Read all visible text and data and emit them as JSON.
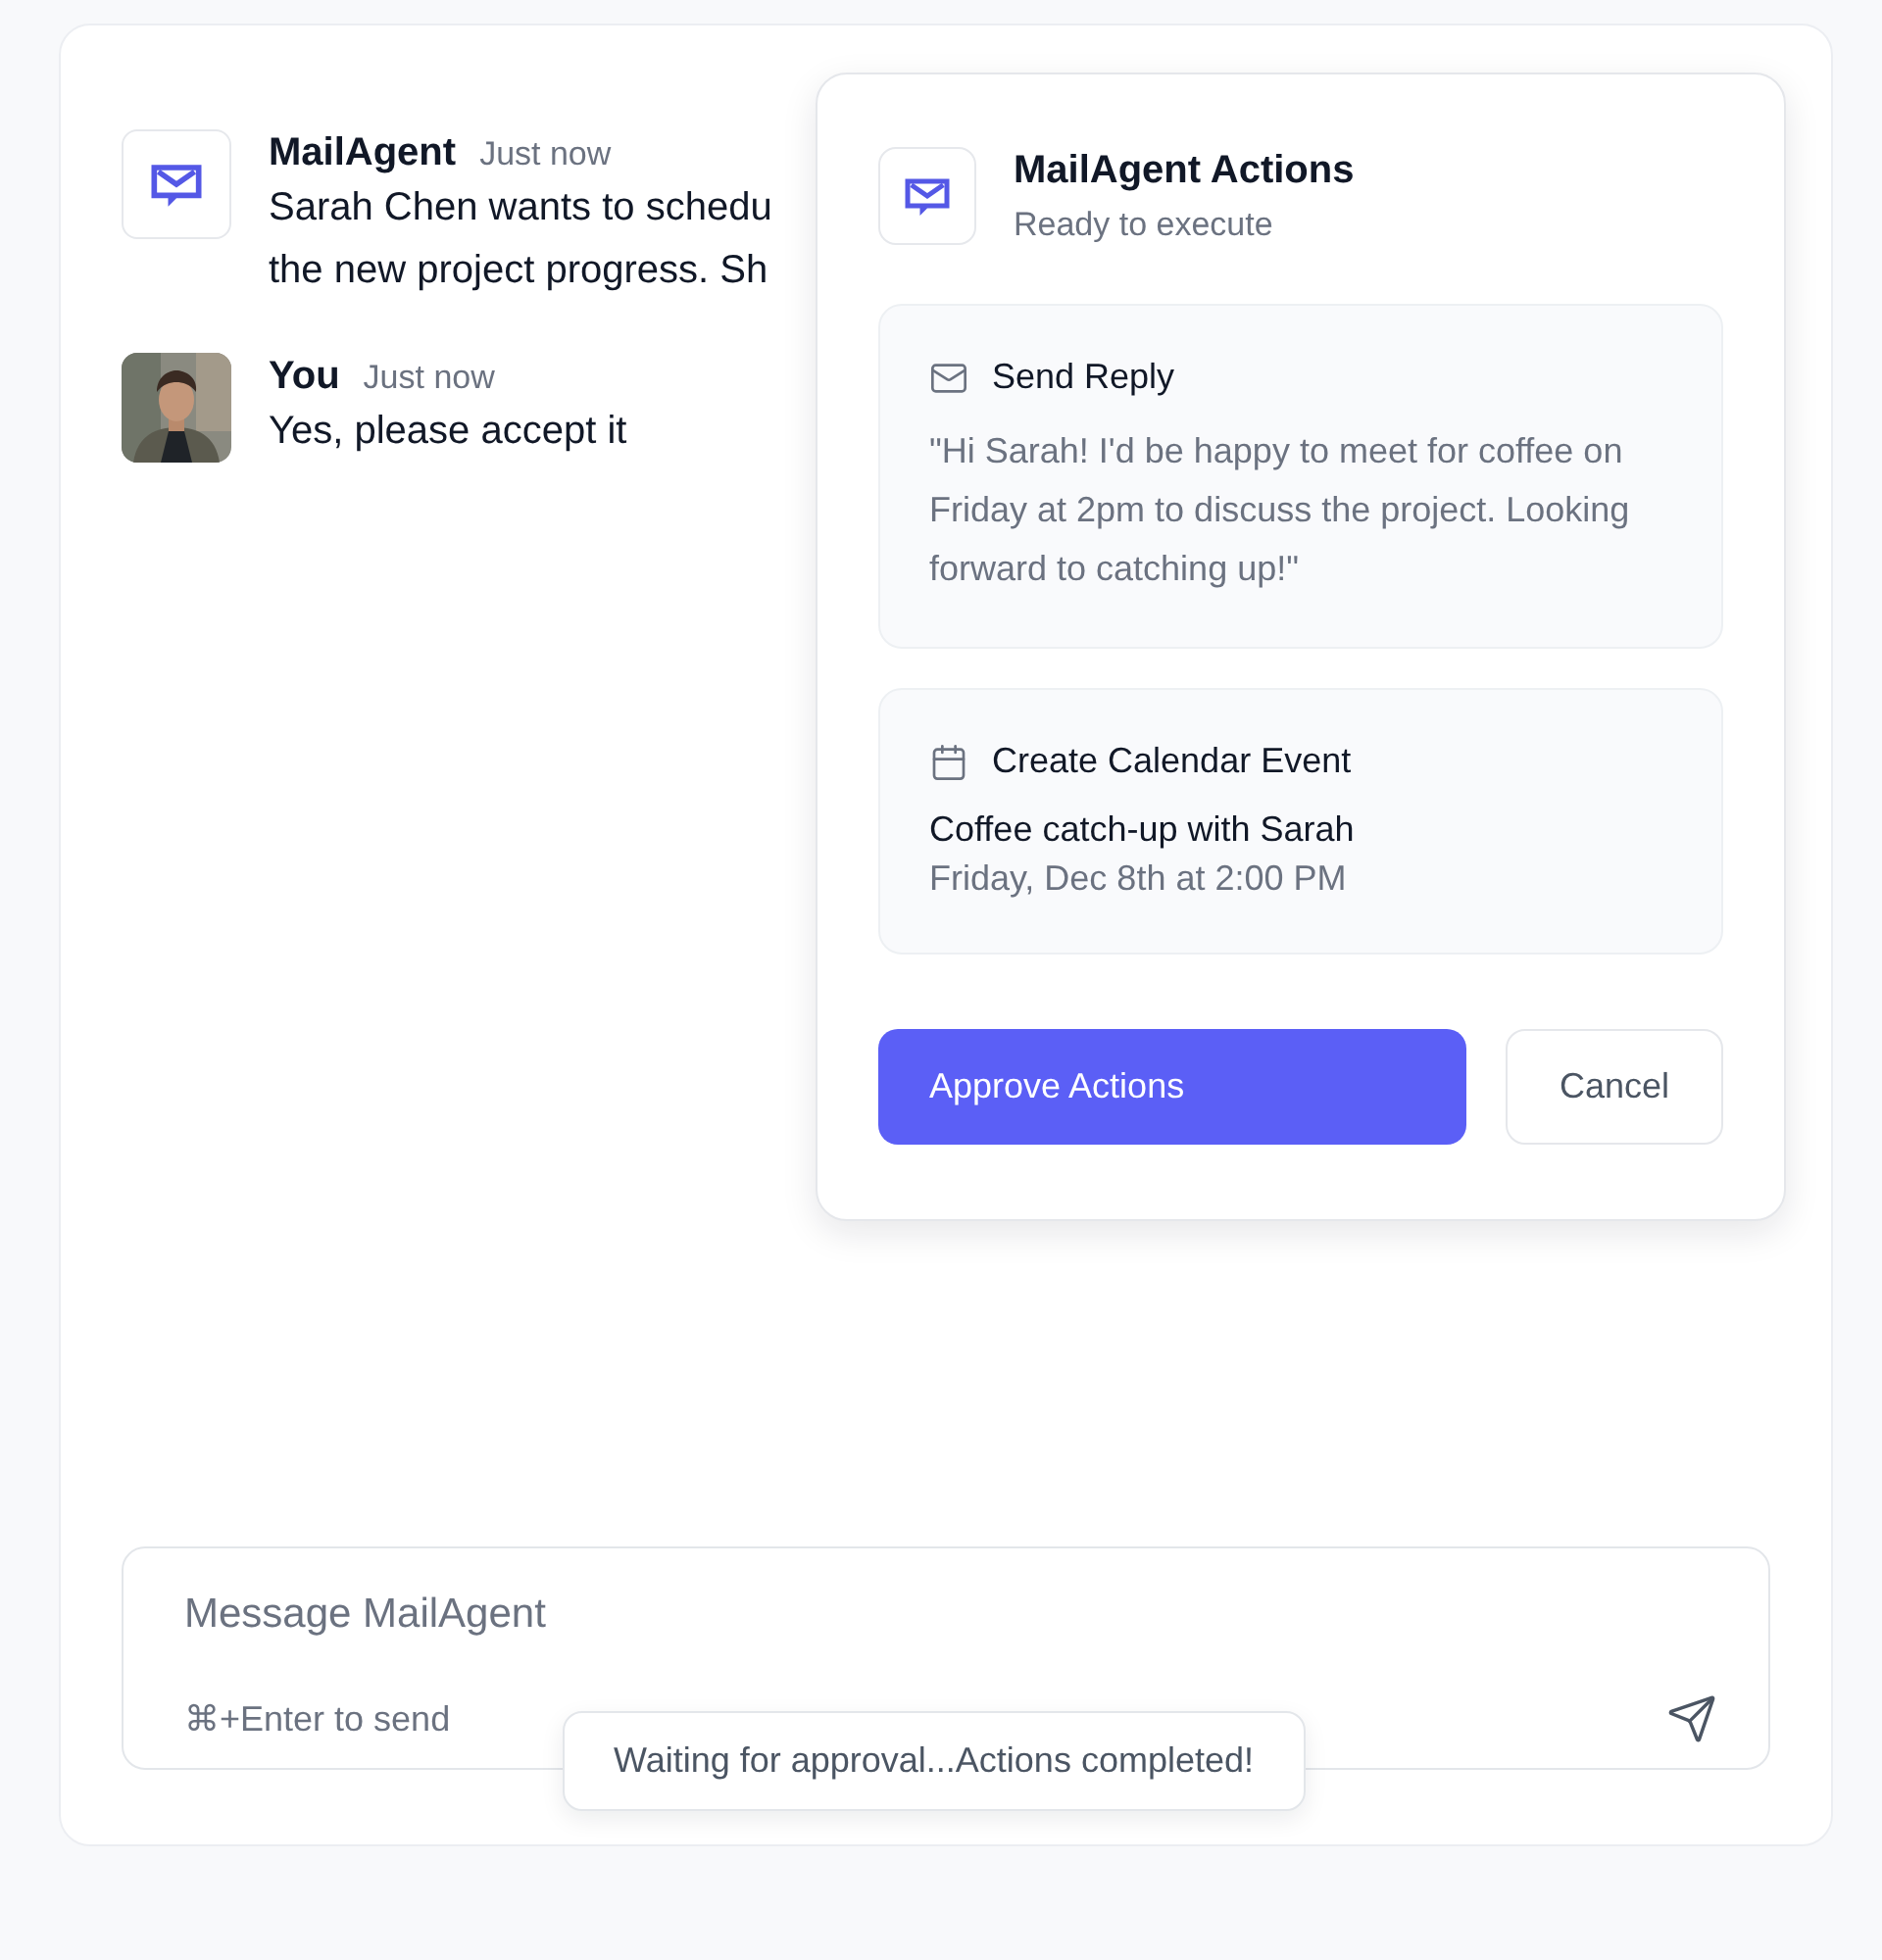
{
  "messages": [
    {
      "kind": "agent",
      "author": "MailAgent",
      "time": "Just now",
      "lines": [
        "Sarah Chen wants to schedu",
        "the new project progress. Sh"
      ]
    },
    {
      "kind": "user",
      "author": "You",
      "time": "Just now",
      "lines": [
        "Yes, please accept it"
      ]
    }
  ],
  "panel": {
    "title": "MailAgent Actions",
    "subtitle": "Ready to execute",
    "actions": [
      {
        "kind": "email",
        "title": "Send Reply",
        "body": "\"Hi Sarah! I'd be happy to meet for coffee on Friday at 2pm to discuss the project. Looking forward to catching up!\""
      },
      {
        "kind": "calendar",
        "title": "Create Calendar Event",
        "event": "Coffee catch-up with Sarah",
        "when": "Friday, Dec 8th at 2:00 PM"
      }
    ],
    "buttons": [
      {
        "kind": "primary",
        "label": "Approve Actions"
      },
      {
        "kind": "secondary",
        "label": "Cancel"
      }
    ]
  },
  "composer": {
    "placeholder": "Message MailAgent",
    "hint": "⌘+Enter to send"
  },
  "toast": {
    "text": "Waiting for approval...Actions completed!"
  }
}
